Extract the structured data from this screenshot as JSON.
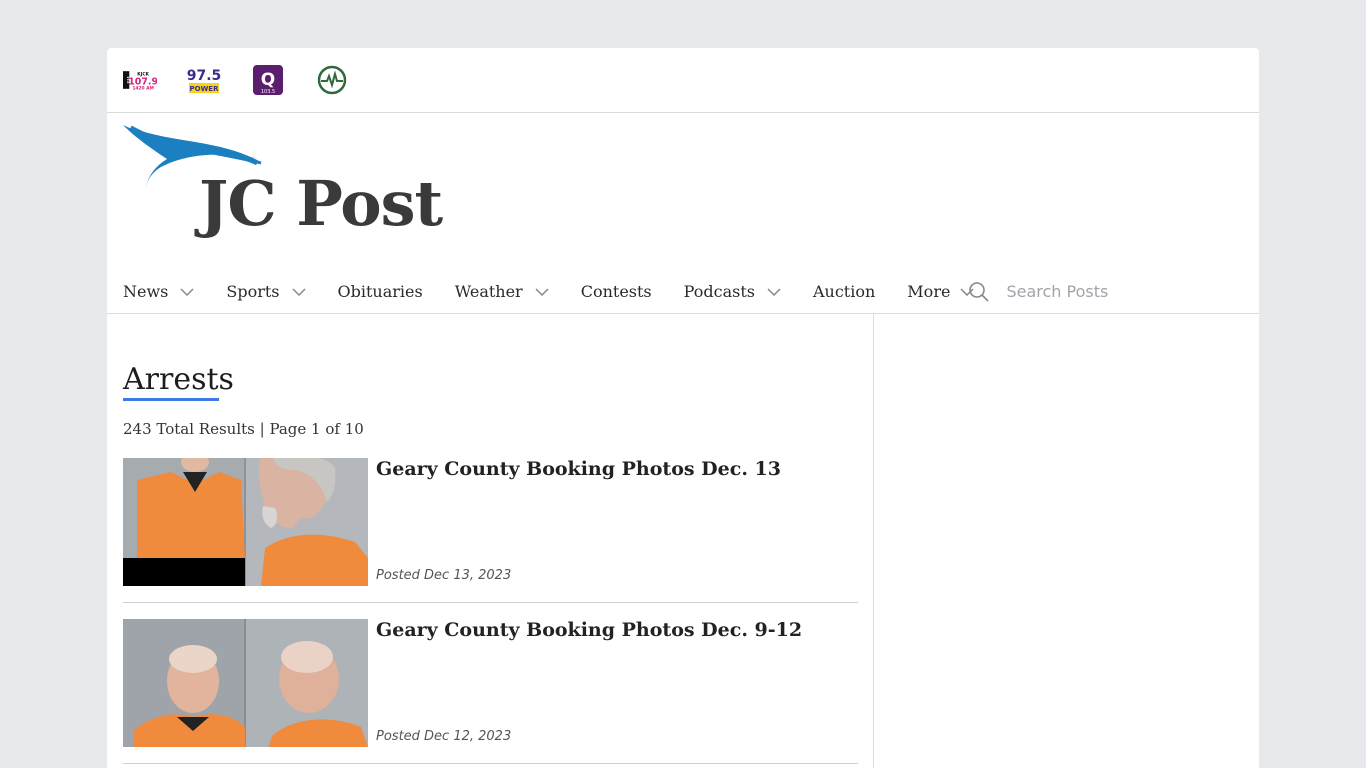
{
  "stations": [
    {
      "name": "kjck-station-logo",
      "top": "KJCK",
      "main": "107.9",
      "sub": "1420 AM",
      "fm": "FM"
    },
    {
      "name": "power-975-station-logo",
      "main": "97.5",
      "sub": "POWER"
    },
    {
      "name": "q-station-logo",
      "main": "Q",
      "sub": "103.5"
    },
    {
      "name": "wave-station-logo"
    }
  ],
  "brand": {
    "title": "JC Post"
  },
  "nav": {
    "items": [
      {
        "label": "News",
        "dropdown": true
      },
      {
        "label": "Sports",
        "dropdown": true
      },
      {
        "label": "Obituaries",
        "dropdown": false
      },
      {
        "label": "Weather",
        "dropdown": true
      },
      {
        "label": "Contests",
        "dropdown": false
      },
      {
        "label": "Podcasts",
        "dropdown": true
      },
      {
        "label": "Auction",
        "dropdown": false
      },
      {
        "label": "More",
        "dropdown": true
      }
    ],
    "search_placeholder": "Search Posts"
  },
  "main": {
    "title": "Arrests",
    "results": "243 Total Results | Page 1 of 10",
    "posts": [
      {
        "title": "Geary County Booking Photos Dec. 13",
        "date": "Posted Dec 13, 2023"
      },
      {
        "title": "Geary County Booking Photos Dec. 9-12",
        "date": "Posted Dec 12, 2023"
      }
    ]
  },
  "colors": {
    "accent": "#3b7be3",
    "logo_blue": "#1b7fc0",
    "logo_text": "#3a3a3a",
    "jumpsuit": "#f08a3c"
  },
  "icons": [
    "chevron-down-icon",
    "search-icon"
  ]
}
